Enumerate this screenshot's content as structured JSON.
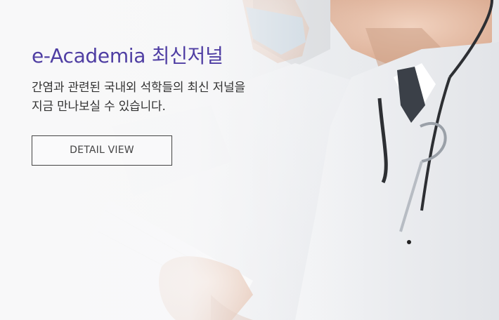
{
  "banner": {
    "title": "e-Academia 최신저널",
    "description": "간염과 관련된 국내외 석학들의 최신 저널을\n지금 만나보실 수 있습니다.",
    "button_label": "DETAIL VIEW"
  },
  "photo": {
    "subject": "doctors-reading-document-photo"
  },
  "colors": {
    "title": "#4f3ea3",
    "text": "#333333",
    "button_border": "#444444",
    "button_text": "#444444"
  }
}
